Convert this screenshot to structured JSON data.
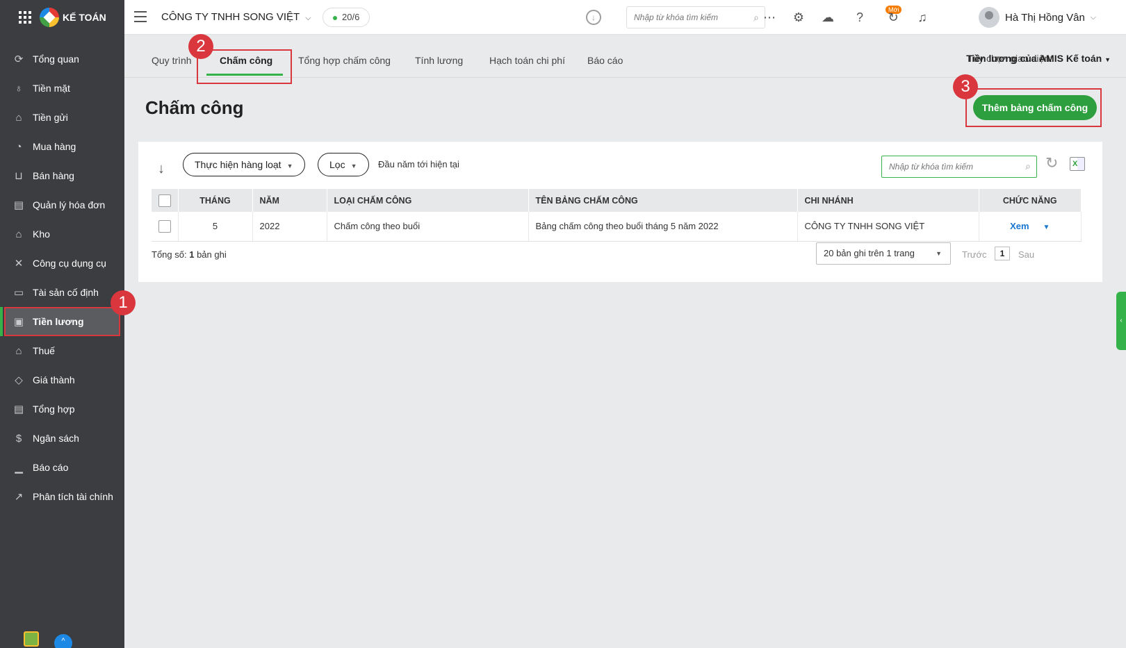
{
  "app": {
    "brand": "KẾ TOÁN"
  },
  "sidebar": {
    "items": [
      {
        "label": "Tổng quan",
        "icon": "⟳"
      },
      {
        "label": "Tiền mặt",
        "icon": "♁"
      },
      {
        "label": "Tiền gửi",
        "icon": "⌂"
      },
      {
        "label": "Mua hàng",
        "icon": "◔"
      },
      {
        "label": "Bán hàng",
        "icon": "⊔"
      },
      {
        "label": "Quản lý hóa đơn",
        "icon": "▤"
      },
      {
        "label": "Kho",
        "icon": "⌂"
      },
      {
        "label": "Công cụ dụng cụ",
        "icon": "✕"
      },
      {
        "label": "Tài sản cố định",
        "icon": "▭"
      },
      {
        "label": "Tiền lương",
        "icon": "▣"
      },
      {
        "label": "Thuế",
        "icon": "⌂"
      },
      {
        "label": "Giá thành",
        "icon": "◇"
      },
      {
        "label": "Tổng hợp",
        "icon": "▤"
      },
      {
        "label": "Ngân sách",
        "icon": "$"
      },
      {
        "label": "Báo cáo",
        "icon": "▁"
      },
      {
        "label": "Phân tích tài chính",
        "icon": "↗"
      }
    ],
    "active_index": 9
  },
  "topbar": {
    "company": "CÔNG TY TNHH SONG VIỆT",
    "date": "20/6",
    "search_placeholder": "Nhập từ khóa tìm kiếm",
    "new_badge": "Mới",
    "user_name": "Hà Thị Hồng Vân"
  },
  "tabs": {
    "items": [
      "Quy trình",
      "Chấm công",
      "Tổng hợp chấm công",
      "Tính lương",
      "Hạch toán chi phí",
      "Báo cáo"
    ],
    "active_index": 1,
    "ui_option_label": "Tùy chọn giao diện:",
    "ui_option_value": "Tiền lương của AMIS Kế toán"
  },
  "page": {
    "title": "Chấm công",
    "add_button": "Thêm bảng chấm công"
  },
  "toolbar": {
    "batch_button": "Thực hiện hàng loạt",
    "filter_button": "Lọc",
    "period": "Đầu năm tới hiện tại",
    "search_placeholder": "Nhập từ khóa tìm kiếm"
  },
  "table": {
    "headers": [
      "THÁNG",
      "NĂM",
      "LOẠI CHẤM CÔNG",
      "TÊN BẢNG CHẤM CÔNG",
      "CHI NHÁNH",
      "CHỨC NĂNG"
    ],
    "rows": [
      {
        "month": "5",
        "year": "2022",
        "type": "Chấm công theo buổi",
        "name": "Bảng chấm công theo buổi tháng 5 năm 2022",
        "branch": "CÔNG TY TNHH SONG VIỆT",
        "action": "Xem"
      }
    ]
  },
  "footer": {
    "total_label": "Tổng số:",
    "total_count": "1",
    "total_suffix": "bản ghi",
    "page_size": "20 bản ghi trên 1 trang",
    "prev": "Trước",
    "page": "1",
    "next": "Sau"
  },
  "callouts": [
    "1",
    "2",
    "3"
  ],
  "colors": {
    "sidebar_bg": "#3c3d40",
    "accent_green": "#35b34a",
    "button_green": "#2e9f3e",
    "highlight_red": "#d9363e"
  }
}
